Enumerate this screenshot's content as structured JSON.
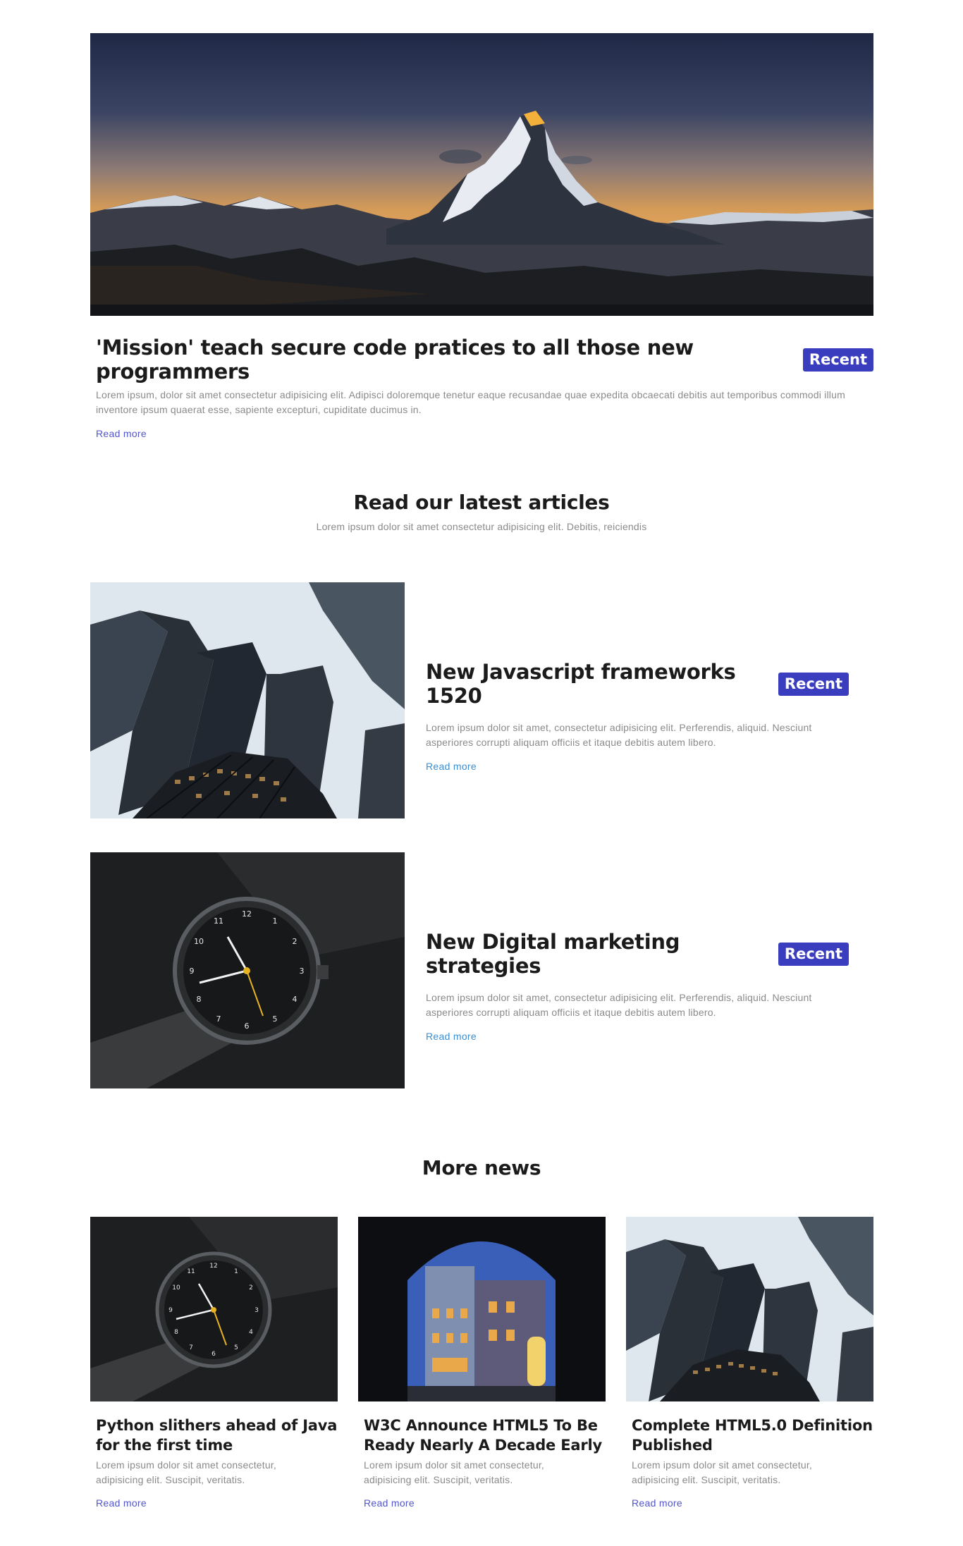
{
  "hero": {
    "image_alt": "Matterhorn mountain at sunset",
    "title": "'Mission' teach secure code pratices to all those new programmers",
    "badge": "Recent",
    "description": "Lorem ipsum, dolor sit amet consectetur adipisicing elit. Adipisci doloremque tenetur eaque recusandae quae expedita obcaecati debitis aut temporibus commodi illum inventore ipsum quaerat esse, sapiente excepturi, cupiditate ducimus in.",
    "read_more": "Read more"
  },
  "latest": {
    "title": "Read our latest articles",
    "subtitle": "Lorem ipsum dolor sit amet consectetur adipisicing elit. Debitis, reiciendis",
    "articles": [
      {
        "title": "New Javascript frameworks 1520",
        "badge": "Recent",
        "description": "Lorem ipsum dolor sit amet, consectetur adipisicing elit. Perferendis, aliquid. Nesciunt asperiores corrupti aliquam officiis et itaque debitis autem libero.",
        "read_more": "Read more"
      },
      {
        "title": "New Digital marketing strategies",
        "badge": "Recent",
        "description": "Lorem ipsum dolor sit amet, consectetur adipisicing elit. Perferendis, aliquid. Nesciunt asperiores corrupti aliquam officiis et itaque debitis autem libero.",
        "read_more": "Read more"
      }
    ]
  },
  "more_news": {
    "title": "More news",
    "cards": [
      {
        "title": "Python slithers ahead of Java for the first time",
        "description": "Lorem ipsum dolor sit amet consectetur, adipisicing elit. Suscipit, veritatis.",
        "read_more": "Read more"
      },
      {
        "title": "W3C Announce HTML5 To Be Ready Nearly A Decade Early",
        "description": "Lorem ipsum dolor sit amet consectetur, adipisicing elit. Suscipit, veritatis.",
        "read_more": "Read more"
      },
      {
        "title": "Complete HTML5.0 Definition Published",
        "description": "Lorem ipsum dolor sit amet consectetur, adipisicing elit. Suscipit, veritatis.",
        "read_more": "Read more"
      }
    ]
  },
  "colors": {
    "badge": "#3b3dbf",
    "link_primary": "#5255c9",
    "link_article": "#3b8ed0",
    "muted_text": "#8a8a8a"
  }
}
